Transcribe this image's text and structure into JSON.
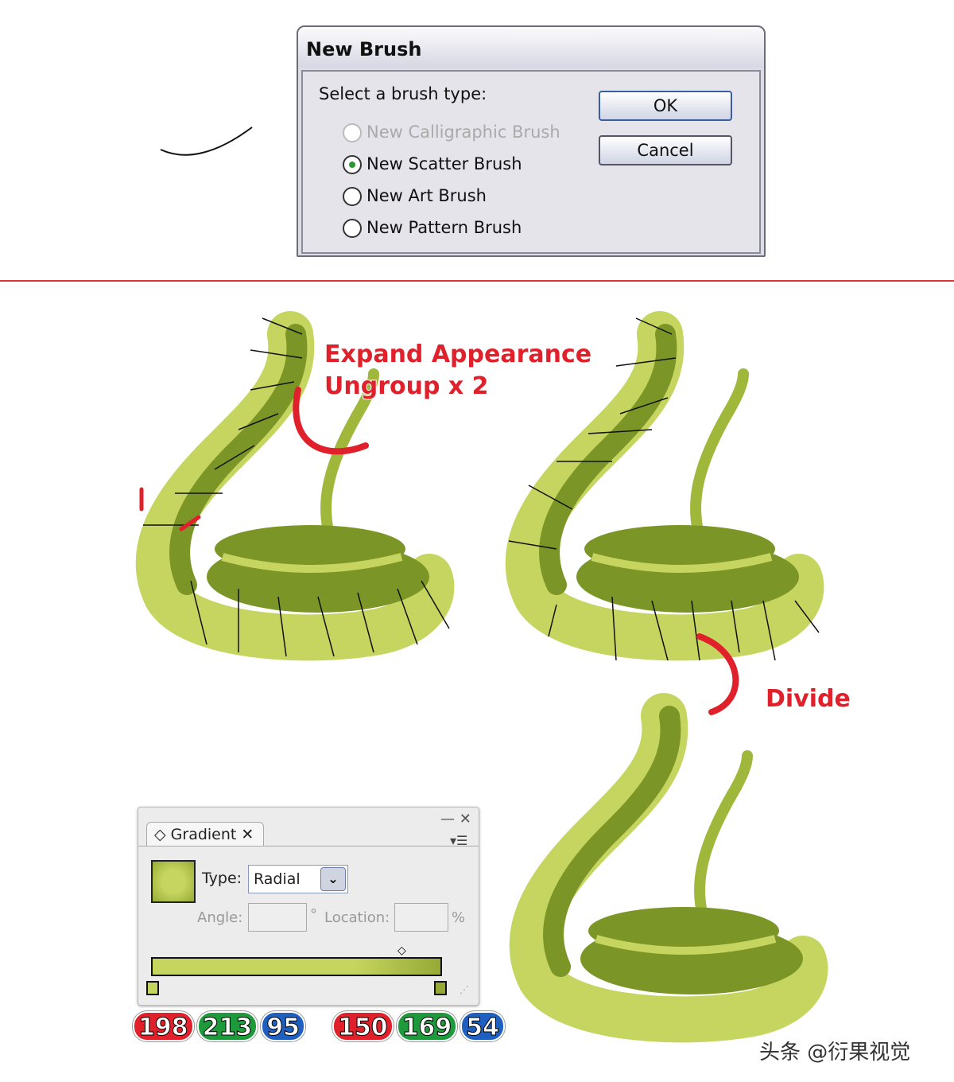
{
  "dialog": {
    "title": "New Brush",
    "prompt": "Select a brush type:",
    "options": [
      {
        "label": "New Calligraphic Brush",
        "enabled": false,
        "selected": false
      },
      {
        "label": "New Scatter Brush",
        "enabled": true,
        "selected": true
      },
      {
        "label": "New Art Brush",
        "enabled": true,
        "selected": false
      },
      {
        "label": "New Pattern Brush",
        "enabled": true,
        "selected": false
      }
    ],
    "ok": "OK",
    "cancel": "Cancel"
  },
  "annotations": {
    "step1": "Expand Appearance",
    "step2": "Ungroup x 2",
    "step3": "Divide"
  },
  "gradient_panel": {
    "tab": "Gradient",
    "type_label": "Type:",
    "type_value": "Radial",
    "angle_label": "Angle:",
    "angle_unit": "°",
    "location_label": "Location:",
    "location_unit": "%"
  },
  "colors": {
    "start": {
      "r": "198",
      "g": "213",
      "b": "95",
      "hex": "#c6d55f"
    },
    "end": {
      "r": "150",
      "g": "169",
      "b": "54",
      "hex": "#96a936"
    },
    "light_green": "#c6d55f",
    "dark_green": "#7b9626",
    "accent_red": "#e0202a"
  },
  "watermark": "头条 @衍果视觉"
}
